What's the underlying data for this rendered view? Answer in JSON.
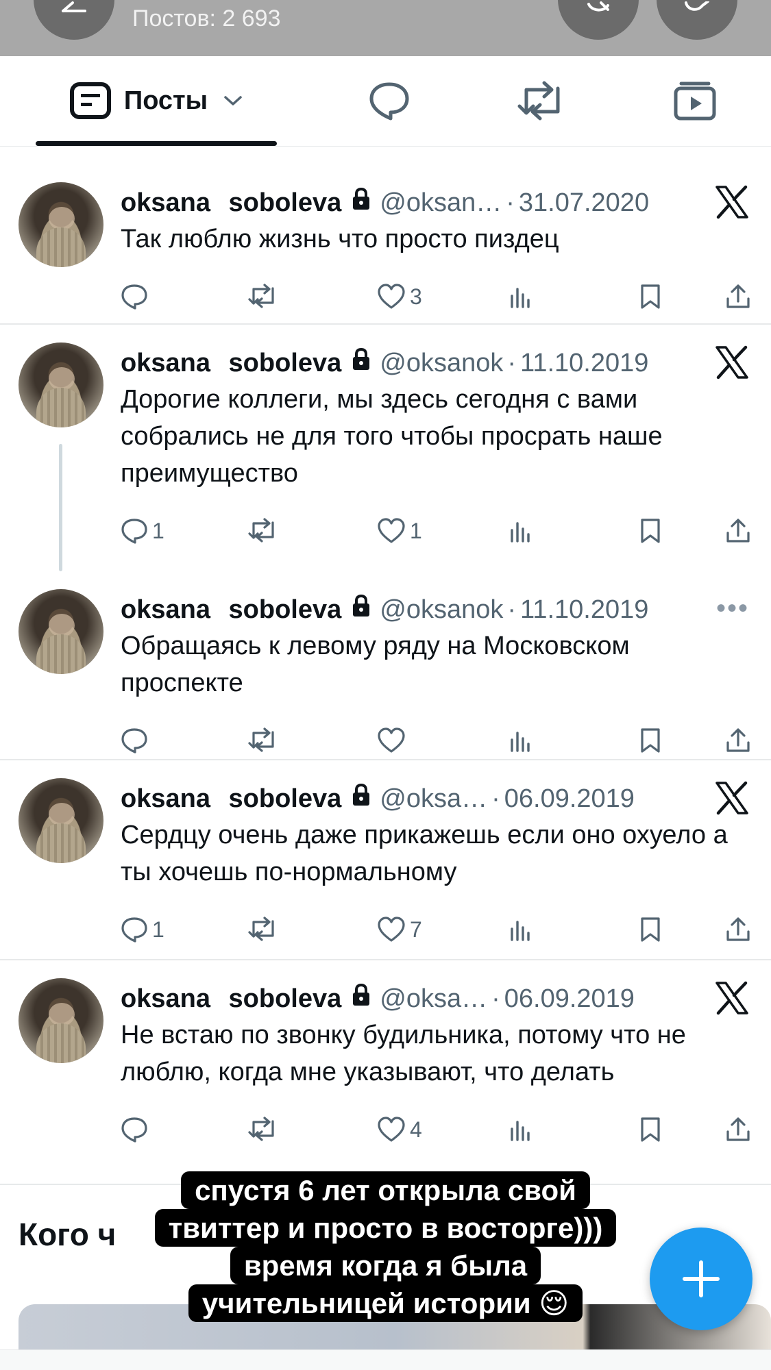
{
  "header": {
    "posts_count": "Постов: 2 693"
  },
  "tabs": {
    "posts_label": "Посты"
  },
  "posts": [
    {
      "name": "oksana soboleva",
      "handle": "@oksan…",
      "date": "31.07.2020",
      "text": "Так люблю жизнь что просто пиздец",
      "replies": "",
      "likes": "3",
      "corner": "x-logo"
    },
    {
      "name": "oksana soboleva",
      "handle": "@oksanok",
      "date": "11.10.2019",
      "text": "Дорогие коллеги, мы здесь сегодня с вами собрались не для того чтобы просрать наше преимущество",
      "replies": "1",
      "likes": "1",
      "corner": "x-logo"
    },
    {
      "name": "oksana soboleva",
      "handle": "@oksanok",
      "date": "11.10.2019",
      "text": "Обращаясь к левому ряду на Московском проспекте",
      "replies": "",
      "likes": "",
      "corner": "more-icon"
    },
    {
      "name": "oksana soboleva",
      "handle": "@oksa…",
      "date": "06.09.2019",
      "text": "Сердцу очень даже прикажешь если оно охуело а ты хочешь по-нормальному",
      "replies": "1",
      "likes": "7",
      "corner": "x-logo"
    },
    {
      "name": "oksana soboleva",
      "handle": "@oksa…",
      "date": "06.09.2019",
      "text": "Не встаю по звонку будильника, потому что не люблю, когда мне указывают, что делать",
      "replies": "",
      "likes": "4",
      "corner": "x-logo"
    }
  ],
  "who_to_follow": {
    "title": "Кого ч"
  },
  "caption": {
    "line1": "спустя 6 лет открыла свой",
    "line2": "твиттер и просто в восторге)))",
    "line3": "время когда я была",
    "line4": "учительницей истории 😌"
  },
  "dot": "·",
  "more_glyph": "•••",
  "colors": {
    "accent": "#1d9bf0",
    "text": "#0f1419",
    "secondary": "#536471",
    "header_bg": "#a8a8a8"
  }
}
